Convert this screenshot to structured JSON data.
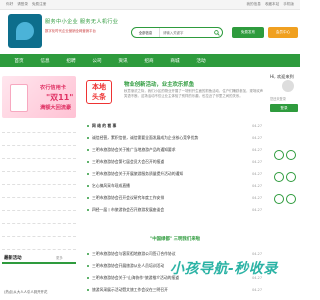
{
  "topbar": {
    "login": "你好",
    "register": "请登录",
    "link1": "免费注册",
    "right1": "我的信息",
    "right2": "收藏本站",
    "right3": "手机版"
  },
  "header": {
    "slogan1": "服务中小企业  服务无人机行业",
    "slogan2": "数字化时代企业营销全网营销平台",
    "slogan3": "",
    "search_category": "全部信息",
    "search_placeholder": "请输入关键字",
    "btn_free": "免费发布",
    "btn_publish": "会员中心"
  },
  "nav": {
    "items": [
      "首页",
      "信息",
      "招聘",
      "公司",
      "资讯",
      "招商",
      "商城",
      "活动"
    ]
  },
  "sidebar": {
    "promo_top": "农行信用卡",
    "promo_mid": "\"双11\"",
    "promo_bottom": "满额大回流豪",
    "promo_phone_title": "",
    "news_title": "最新活动",
    "news_more": "更多",
    "news_item": "(热点)从大人人引人到开开花"
  },
  "toutiao": {
    "top": "本地",
    "bottom": "头条"
  },
  "headline": {
    "title": "物业创新活动，业主欢乐抓鱼",
    "desc": "秋意渐浓之际，我们小区的物业开展了一场别开生面的抓鱼活动，住户们踊跃参加，现场欢声笑语不断。这场活动不仅让业主体验了别样的乐趣，也拉近了邻里之间的关系。"
  },
  "news": [
    {
      "text": "网 络 的 看 事",
      "date": "04-27"
    },
    {
      "text": "诚信经营，累积信誉，诚信需要全面发展成为企业核心竞争优势",
      "date": "04-27"
    },
    {
      "text": "三明市旅游协会关于推广当地旅游产品的通知要求",
      "date": "04-27"
    },
    {
      "text": "三明市旅游协会第七届会员大会召开的报道",
      "date": "04-27"
    },
    {
      "text": "三明市旅游协会关于开展旅游服务质量提升活动的通知",
      "date": "04-27"
    },
    {
      "text": "乞心搞风采车现成直播",
      "date": "04-27"
    },
    {
      "text": "三明市旅游协会召开会议研究年度工作安排",
      "date": "04-27"
    },
    {
      "text": "四经一届丨市旅游协会召开旅游发展座谈会",
      "date": "04-27"
    }
  ],
  "mid_title": "\"中国绿都\" 三明我们来啦",
  "news2": [
    {
      "text": "三明市旅游协会与客家祖地旅游公司签订合作协议",
      "date": "04-27"
    },
    {
      "text": "三明市旅游协会开展旅游从业人员培训活动",
      "date": "04-27"
    },
    {
      "text": "三明市旅游协会关于\"山海协作\"旅游推介活动的报道",
      "date": "04-27"
    },
    {
      "text": "旅游风采展示活动暨文旅工作会议在三明召开",
      "date": "04-27"
    },
    {
      "text": "福建省旅游协会第四届理事会第一次会议召开",
      "date": "04-27"
    }
  ],
  "login": {
    "greet": "Hi, 欢迎来到",
    "hint": "您还未登录",
    "btn": "登录"
  },
  "watermark": "小孩导航-秒收录"
}
